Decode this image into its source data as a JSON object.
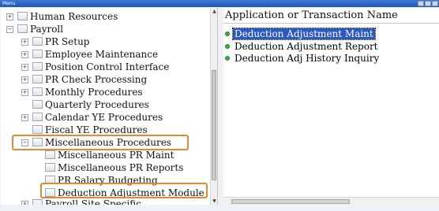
{
  "window": {
    "title": "Menu"
  },
  "tree": {
    "nodes": [
      {
        "label": "Human Resources",
        "expander": "+"
      },
      {
        "label": "Payroll",
        "expander": "−"
      },
      {
        "label": "PR Setup",
        "expander": "+"
      },
      {
        "label": "Employee Maintenance",
        "expander": "+"
      },
      {
        "label": "Position Control Interface",
        "expander": "+"
      },
      {
        "label": "PR Check Processing",
        "expander": "+"
      },
      {
        "label": "Monthly Procedures",
        "expander": "+"
      },
      {
        "label": "Quarterly Procedures",
        "expander": ""
      },
      {
        "label": "Calendar YE Procedures",
        "expander": "+"
      },
      {
        "label": "Fiscal YE Procedures",
        "expander": ""
      },
      {
        "label": "Miscellaneous Procedures",
        "expander": "−"
      },
      {
        "label": "Miscellaneous PR Maint",
        "expander": ""
      },
      {
        "label": "Miscellaneous PR Reports",
        "expander": ""
      },
      {
        "label": "PR Salary Budgeting",
        "expander": ""
      },
      {
        "label": "Deduction Adjustment Module",
        "expander": ""
      },
      {
        "label": "Payroll Site Specific",
        "expander": "+"
      }
    ]
  },
  "list": {
    "header": "Application or Transaction Name",
    "items": [
      {
        "label": "Deduction Adjustment Maint"
      },
      {
        "label": "Deduction Adjustment Report"
      },
      {
        "label": "Deduction Adj History Inquiry"
      }
    ]
  },
  "colors": {
    "highlight_box": "#e8872e",
    "selection": "#2b59c3",
    "status_dot": "#37b34a"
  }
}
